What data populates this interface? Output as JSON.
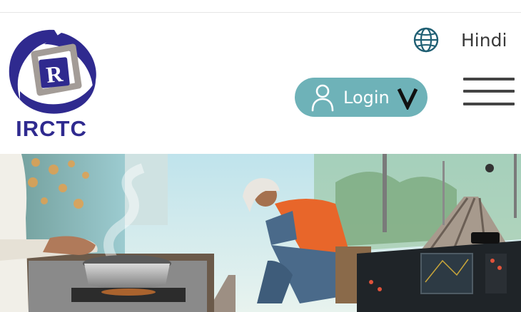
{
  "brand": {
    "name": "IRCTC",
    "logo_letter": "R",
    "primary_color": "#2f2a8f",
    "accent_color": "#a39c97"
  },
  "header": {
    "language": {
      "icon": "globe-icon",
      "label": "Hindi"
    },
    "login": {
      "icon": "user-icon",
      "label": "Login",
      "caret_icon": "chevron-down-icon",
      "color": "#6eb2b8"
    },
    "menu": {
      "icon": "hamburger-menu-icon"
    }
  },
  "banner": {
    "description_icon": "hero-banner-image"
  }
}
